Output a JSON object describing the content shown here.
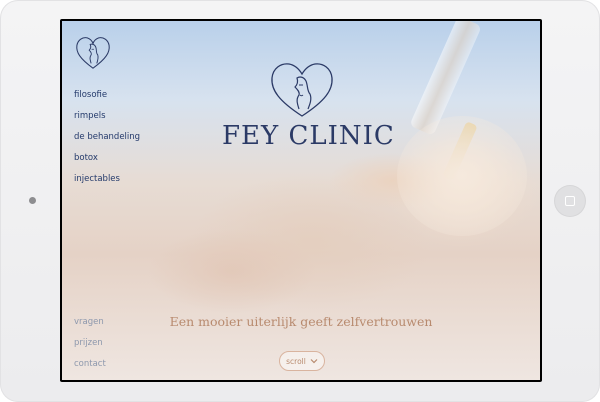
{
  "brand": {
    "name": "FEY CLINIC",
    "tagline": "Een mooier uiterlijk geeft zelfvertrouwen",
    "icon": "heart-face-logo"
  },
  "nav": {
    "primary": [
      {
        "label": "filosofie"
      },
      {
        "label": "rimpels"
      },
      {
        "label": "de behandeling"
      },
      {
        "label": "botox"
      },
      {
        "label": "injectables"
      }
    ],
    "secondary": [
      {
        "label": "vragen"
      },
      {
        "label": "prijzen"
      },
      {
        "label": "contact"
      }
    ]
  },
  "scroll_button": {
    "label": "scroll",
    "icon": "chevron-down-icon"
  },
  "colors": {
    "navy": "#243a6b",
    "accent": "#b88a6e",
    "muted": "#8d98ad"
  }
}
